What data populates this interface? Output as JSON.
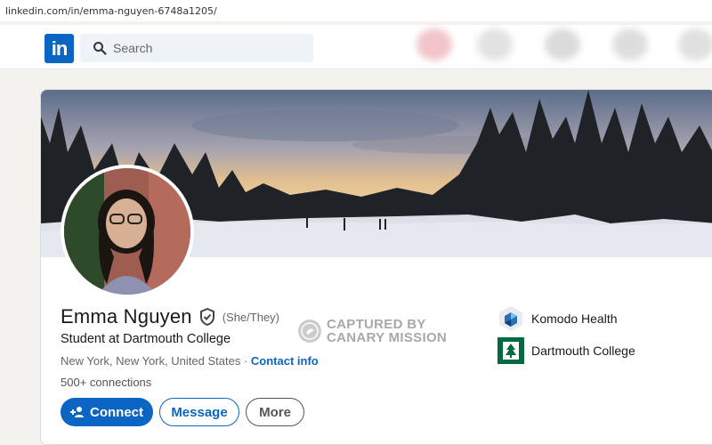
{
  "browser": {
    "url": "linkedin.com/in/emma-nguyen-6748a1205/"
  },
  "nav": {
    "logo_text": "in",
    "search_placeholder": "Search"
  },
  "profile": {
    "name": "Emma Nguyen",
    "pronouns": "(She/They)",
    "headline": "Student at Dartmouth College",
    "location": "New York, New York, United States",
    "separator": " · ",
    "contact_info": "Contact info",
    "connections": "500+ connections",
    "verified_icon": "shield-check-icon"
  },
  "actions": {
    "connect": "Connect",
    "message": "Message",
    "more": "More"
  },
  "watermark": {
    "line1": "CAPTURED BY",
    "line2": "CANARY MISSION"
  },
  "orgs": [
    {
      "name": "Komodo Health",
      "icon": "komodo-health-logo"
    },
    {
      "name": "Dartmouth College",
      "icon": "dartmouth-logo"
    }
  ],
  "colors": {
    "brand": "#0a66c2",
    "dartmouth_green": "#00693e"
  }
}
